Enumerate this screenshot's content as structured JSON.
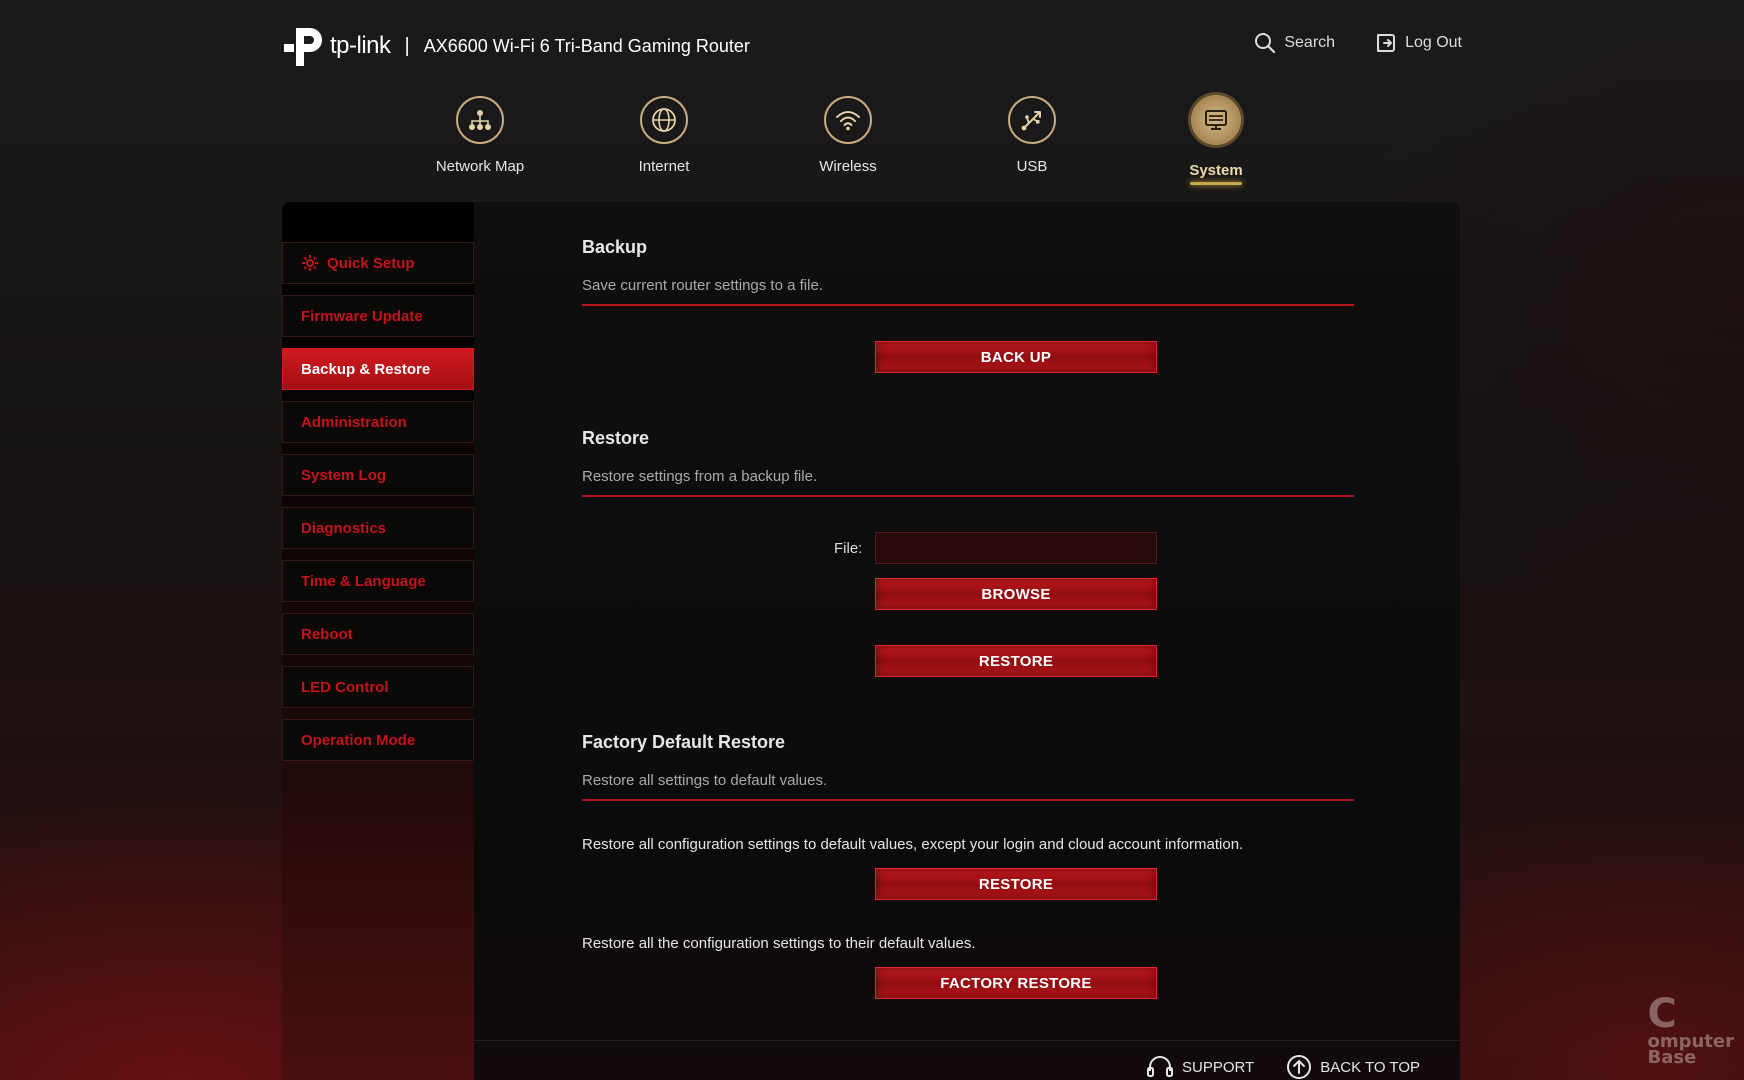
{
  "header": {
    "brand": "tp-link",
    "separator": "|",
    "model": "AX6600 Wi-Fi 6 Tri-Band Gaming Router",
    "search_label": "Search",
    "logout_label": "Log Out"
  },
  "topnav": [
    {
      "label": "Network Map",
      "icon": "network-map-icon"
    },
    {
      "label": "Internet",
      "icon": "globe-icon"
    },
    {
      "label": "Wireless",
      "icon": "wifi-icon"
    },
    {
      "label": "USB",
      "icon": "usb-icon"
    },
    {
      "label": "System",
      "icon": "system-icon",
      "active": true
    }
  ],
  "sidebar": {
    "items": [
      {
        "label": "Quick Setup",
        "icon": "gear-icon"
      },
      {
        "label": "Firmware Update"
      },
      {
        "label": "Backup & Restore",
        "active": true
      },
      {
        "label": "Administration"
      },
      {
        "label": "System Log"
      },
      {
        "label": "Diagnostics"
      },
      {
        "label": "Time & Language"
      },
      {
        "label": "Reboot"
      },
      {
        "label": "LED Control"
      },
      {
        "label": "Operation Mode"
      }
    ]
  },
  "backup": {
    "title": "Backup",
    "desc": "Save current router settings to a file.",
    "button": "BACK UP"
  },
  "restore": {
    "title": "Restore",
    "desc": "Restore settings from a backup file.",
    "file_label": "File:",
    "file_value": "",
    "browse_button": "BROWSE",
    "restore_button": "RESTORE"
  },
  "factory": {
    "title": "Factory Default Restore",
    "desc": "Restore all settings to default values.",
    "text1": "Restore all configuration settings to default values, except your login and cloud account information.",
    "button1": "RESTORE",
    "text2": "Restore all the configuration settings to their default values.",
    "button2": "FACTORY RESTORE"
  },
  "footer": {
    "support": "SUPPORT",
    "back_to_top": "BACK TO TOP"
  },
  "watermark": {
    "c": "C",
    "line1": "omputer",
    "line2": "Base"
  },
  "colors": {
    "accent_red": "#c4141b",
    "active_gold": "#c9ac7d",
    "background": "#161212"
  }
}
